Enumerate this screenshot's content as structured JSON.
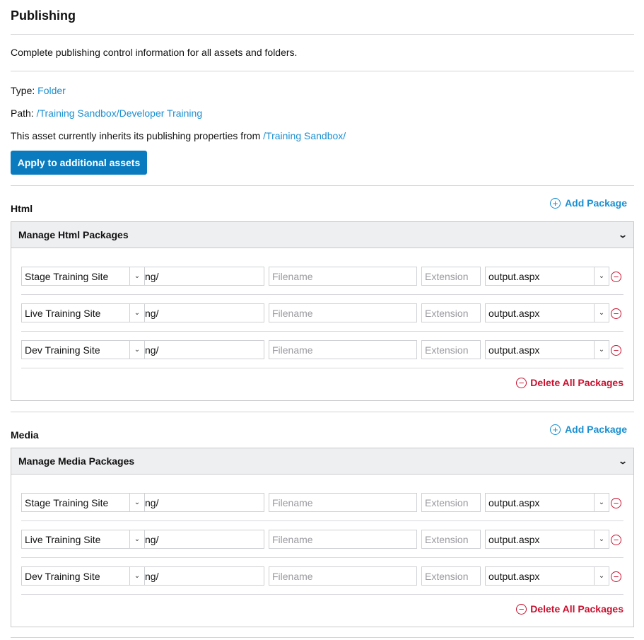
{
  "page": {
    "title": "Publishing",
    "description": "Complete publishing control information for all assets and folders.",
    "type_label": "Type:",
    "type_value": "Folder",
    "path_label": "Path:",
    "path_value": "/Training Sandbox/Developer Training",
    "inherit_text": "This asset currently inherits its publishing properties from",
    "inherit_link": "/Training Sandbox/",
    "apply_button": "Apply to additional assets"
  },
  "colors": {
    "accent": "#0b7bbf",
    "link": "#1b8fd1",
    "danger": "#c8102e",
    "panel_header": "#eeeff1"
  },
  "sections": [
    {
      "label": "Html",
      "add_package": "Add Package",
      "panel_title": "Manage Html Packages",
      "delete_all": "Delete All Packages",
      "rows": [
        {
          "site": "Stage Training Site",
          "path": "ng/",
          "filename_placeholder": "Filename",
          "extension_placeholder": "Extension",
          "output": "output.aspx"
        },
        {
          "site": "Live Training Site",
          "path": "ng/",
          "filename_placeholder": "Filename",
          "extension_placeholder": "Extension",
          "output": "output.aspx"
        },
        {
          "site": "Dev Training Site",
          "path": "ng/",
          "filename_placeholder": "Filename",
          "extension_placeholder": "Extension",
          "output": "output.aspx"
        }
      ]
    },
    {
      "label": "Media",
      "add_package": "Add Package",
      "panel_title": "Manage Media Packages",
      "delete_all": "Delete All Packages",
      "rows": [
        {
          "site": "Stage Training Site",
          "path": "ng/",
          "filename_placeholder": "Filename",
          "extension_placeholder": "Extension",
          "output": "output.aspx"
        },
        {
          "site": "Live Training Site",
          "path": "ng/",
          "filename_placeholder": "Filename",
          "extension_placeholder": "Extension",
          "output": "output.aspx"
        },
        {
          "site": "Dev Training Site",
          "path": "ng/",
          "filename_placeholder": "Filename",
          "extension_placeholder": "Extension",
          "output": "output.aspx"
        }
      ]
    }
  ],
  "icons": {
    "add": "plus-circle-icon",
    "remove": "minus-circle-icon",
    "collapse": "chevron-down-icon",
    "select": "select-arrow-icon"
  }
}
